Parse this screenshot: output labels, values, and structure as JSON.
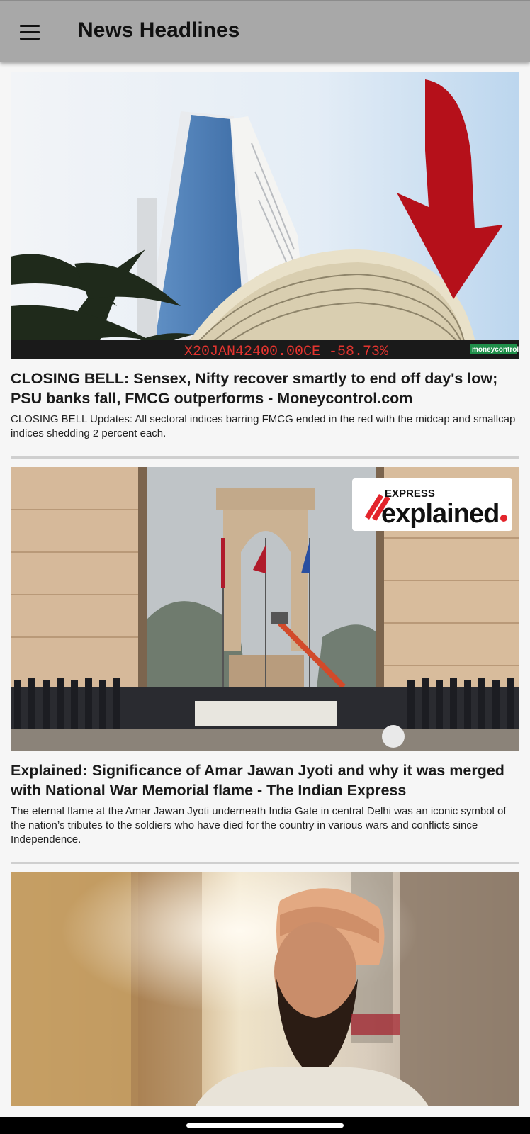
{
  "app_bar": {
    "title": "News Headlines",
    "menu_icon": "hamburger-menu-icon"
  },
  "articles": [
    {
      "headline": "CLOSING BELL: Sensex, Nifty recover smartly to end off day's low; PSU banks fall, FMCG outperforms - Moneycontrol.com",
      "summary": "CLOSING BELL Updates: All sectoral indices barring FMCG ended in the red with the midcap and smallcap indices shedding 2 percent each.",
      "image": {
        "ticker_text": "X20JAN42400.00CE -58.73%",
        "watermark": "moneycontrol"
      }
    },
    {
      "headline": "Explained: Significance of Amar Jawan Jyoti and why it was merged with National War Memorial flame - The Indian Express",
      "summary": "The eternal flame at the Amar Jawan Jyoti underneath India Gate in central Delhi was an iconic symbol of the nation’s tributes to the soldiers who have died for the country in various wars and conflicts since Independence.",
      "image": {
        "badge_top": "EXPRESS",
        "badge_main": "explained"
      }
    },
    {
      "headline": "",
      "summary": "",
      "image": {}
    }
  ]
}
